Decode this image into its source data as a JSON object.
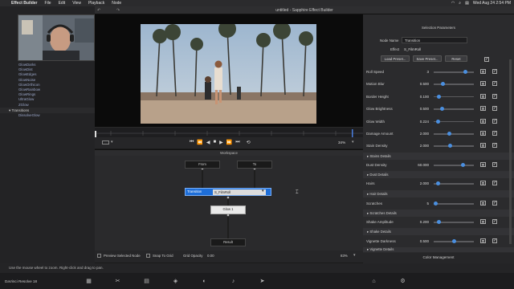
{
  "menubar": {
    "app": "Effect Builder",
    "items": [
      "File",
      "Edit",
      "View",
      "Playback",
      "Node"
    ],
    "clock": "Wed Aug 24  2:54 PM"
  },
  "window": {
    "title": "untitled - Sapphire Effect Builder"
  },
  "left_tree": {
    "items": [
      "GlowDarks",
      "GlowDist",
      "GlowEdges",
      "GlowNoise",
      "GlowOrthicon",
      "GlowRainbow",
      "GlowRings",
      "UltraGlow",
      "ZGlow"
    ],
    "section": "Transitions",
    "section_items": [
      "DissolveGlow"
    ]
  },
  "transport": {
    "zoom": "34%"
  },
  "workspace": {
    "title": "Workspace",
    "nodes": {
      "from": "From",
      "to": "To",
      "transition_label": "Transition",
      "transition_effect": "S_FilmRoll",
      "glow": "Glow 1",
      "result": "Result"
    },
    "footer": {
      "preview": "Preview Selected Node",
      "snap": "Snap To Grid",
      "grid_opacity_label": "Grid Opacity",
      "grid_opacity_value": "0.00",
      "zoom": "83%"
    }
  },
  "selection": {
    "title": "Selection Parameters",
    "node_name_label": "Node Name",
    "node_name_value": "Transition",
    "effect_label": "Effect",
    "effect_value": "S_FilmRoll",
    "load_preset": "Load Preset...",
    "save_preset": "Save Preset...",
    "reset": "Reset",
    "params": [
      {
        "label": "Roll Speed",
        "value": "3",
        "pos": 0.78
      },
      {
        "label": "Motion Blur",
        "value": "0.500",
        "pos": 0.22
      },
      {
        "label": "Border Height",
        "value": "0.100",
        "pos": 0.12
      },
      {
        "label": "Glow Brightness",
        "value": "0.500",
        "pos": 0.2
      },
      {
        "label": "Glow Width",
        "value": "0.224",
        "pos": 0.1
      },
      {
        "label": "Damage Amount",
        "value": "2.000",
        "pos": 0.38
      },
      {
        "label": "Stain Density",
        "value": "2.000",
        "pos": 0.4
      }
    ],
    "sec_stains": "Stains Details",
    "dust": {
      "label": "Dust Density",
      "value": "60.000",
      "pos": 0.72
    },
    "sec_dust": "Dust Details",
    "hairs": {
      "label": "Hairs",
      "value": "2.000",
      "pos": 0.1
    },
    "sec_hair": "Hair Details",
    "scratches": {
      "label": "Scratches",
      "value": "5",
      "pos": 0.05
    },
    "sec_scratches": "Scratches Details",
    "shake": {
      "label": "Shake Amplitude",
      "value": "0.200",
      "pos": 0.12
    },
    "sec_shake": "Shake Details",
    "vignette": {
      "label": "Vignette Darkness",
      "value": "0.500",
      "pos": 0.5
    },
    "sec_vignette": "Vignette Details",
    "color_mgmt": "Color Management",
    "cancel": "Cancel",
    "ok": "OK"
  },
  "statusbar": {
    "hint": "Use the mouse wheel to zoom.  Right-click and drag to pan."
  },
  "dock": {
    "app": "DaVinci Resolve 18"
  }
}
